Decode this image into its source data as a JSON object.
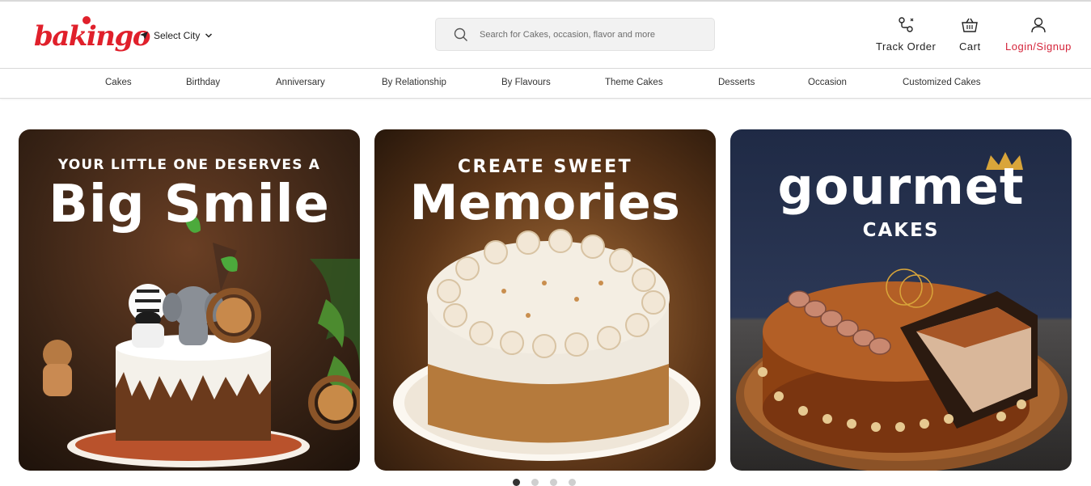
{
  "brand": {
    "name": "bakingo",
    "color": "#e0202b"
  },
  "header": {
    "city_label": "Select City",
    "search_placeholder": "Search for Cakes, occasion, flavor and more",
    "track_order": "Track Order",
    "cart": "Cart",
    "login": "Login/Signup",
    "accent": "#d4243a"
  },
  "nav": {
    "items": [
      "Cakes",
      "Birthday",
      "Anniversary",
      "By Relationship",
      "By Flavours",
      "Theme Cakes",
      "Desserts",
      "Occasion",
      "Customized Cakes"
    ]
  },
  "banners": [
    {
      "line1": "YOUR LITTLE ONE DESERVES A",
      "line2": "Big Smile",
      "image": "animal-theme-kids-cake"
    },
    {
      "line1": "CREATE SWEET",
      "line2": "Memories",
      "image": "butterscotch-cream-cake"
    },
    {
      "line1": "gourmet",
      "line2": "CAKES",
      "image": "chocolate-hazelnut-gourmet-cake"
    }
  ],
  "carousel": {
    "total_slides": 4,
    "active_slide": 1
  }
}
